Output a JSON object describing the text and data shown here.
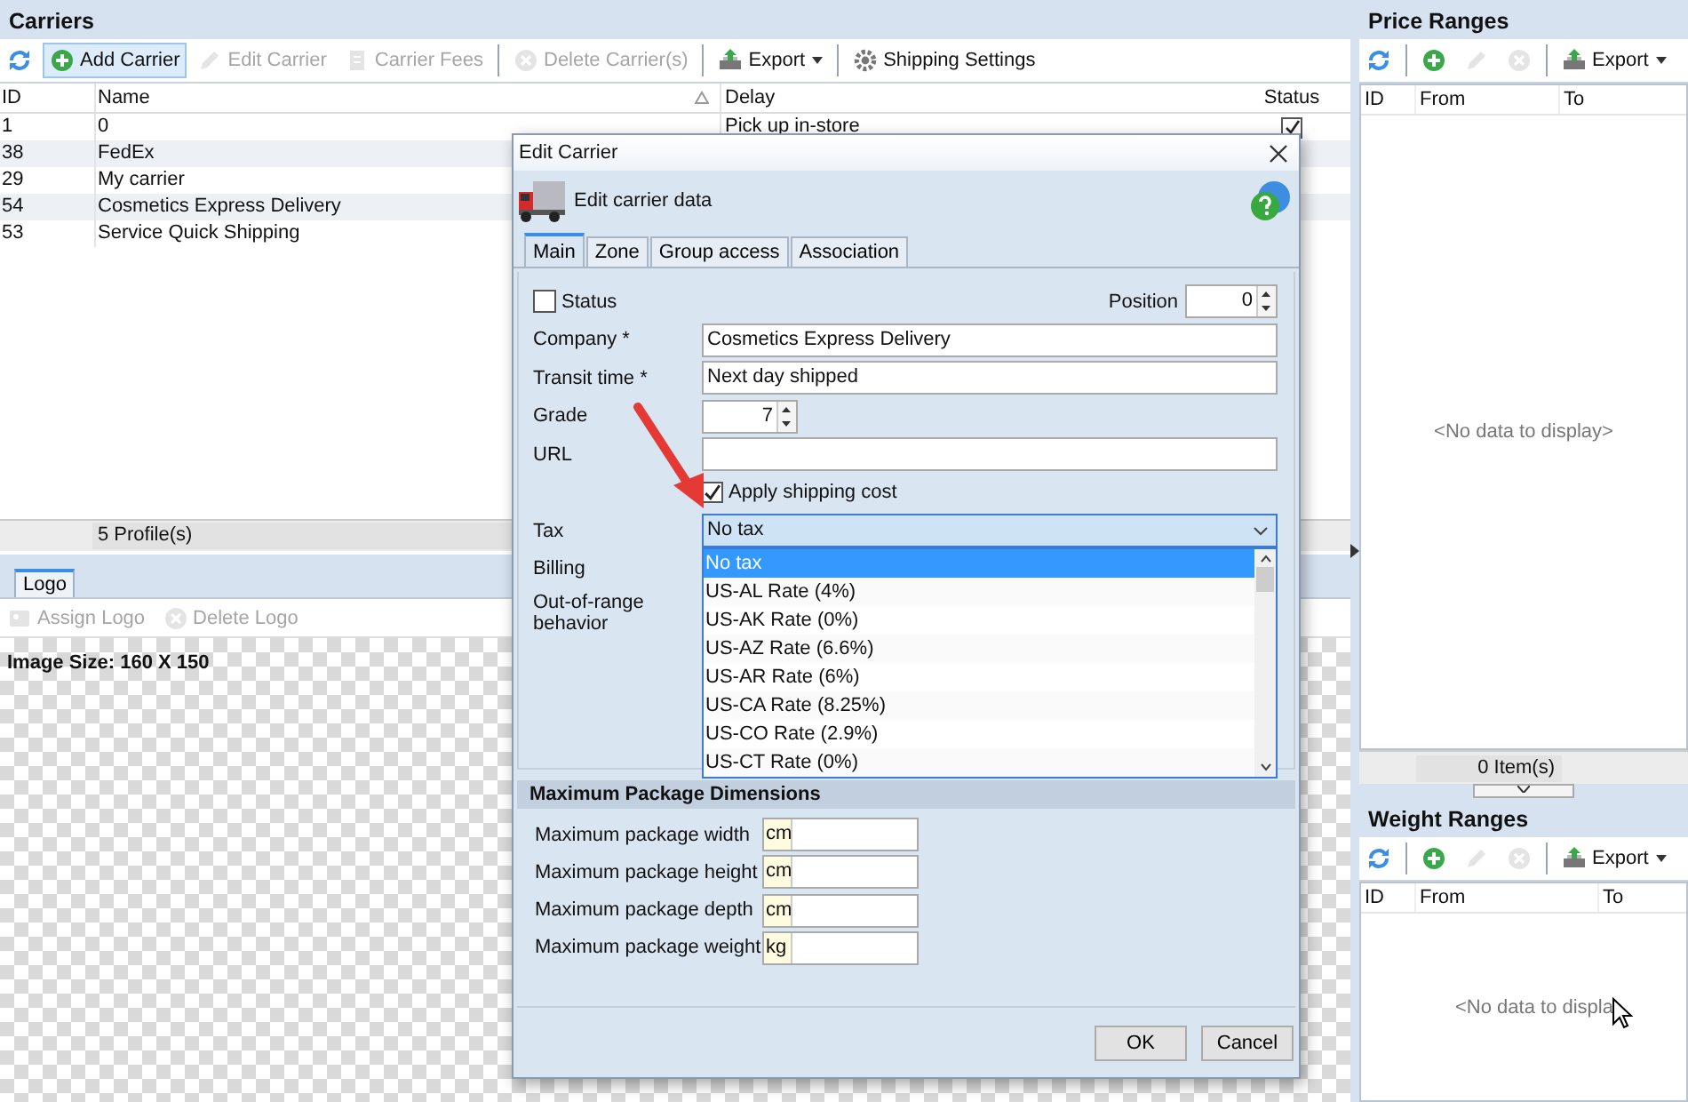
{
  "carriers": {
    "title": "Carriers",
    "toolbar": [
      {
        "kind": "refresh",
        "disabled": false,
        "hovered": false,
        "separator_before": false
      },
      {
        "kind": "add",
        "label": "Add Carrier",
        "disabled": false,
        "hovered": true,
        "separator_before": false
      },
      {
        "kind": "edit",
        "label": "Edit Carrier",
        "disabled": true,
        "hovered": false,
        "separator_before": false
      },
      {
        "kind": "fees",
        "label": "Carrier Fees",
        "disabled": true,
        "hovered": false,
        "separator_before": false
      },
      {
        "kind": "delete",
        "label": "Delete Carrier(s)",
        "disabled": true,
        "hovered": false,
        "separator_before": true
      },
      {
        "kind": "export",
        "label": "Export",
        "disabled": false,
        "hovered": false,
        "separator_before": true,
        "dropdown": true
      },
      {
        "kind": "settings",
        "label": "Shipping Settings",
        "disabled": false,
        "hovered": false,
        "separator_before": true
      }
    ],
    "columns": [
      {
        "label": "ID",
        "sorted": false
      },
      {
        "label": "Name",
        "sorted": true
      },
      {
        "label": "Delay",
        "sorted": false
      },
      {
        "label": "Status",
        "sorted": false
      }
    ],
    "rows": [
      {
        "id": "1",
        "name": "0",
        "delay": "Pick up in-store",
        "status": true
      },
      {
        "id": "38",
        "name": "FedEx"
      },
      {
        "id": "29",
        "name": "My carrier"
      },
      {
        "id": "54",
        "name": "Cosmetics Express Delivery"
      },
      {
        "id": "53",
        "name": "Service Quick Shipping"
      }
    ],
    "footer": "5 Profile(s)"
  },
  "logo": {
    "tabs": [
      {
        "label": "Logo",
        "selected": true
      }
    ],
    "toolbar": [
      {
        "kind": "assign",
        "label": "Assign Logo",
        "disabled": true
      },
      {
        "kind": "delete",
        "label": "Delete Logo",
        "disabled": true
      }
    ],
    "image_size": "Image Size: 160 X 150"
  },
  "price_ranges": {
    "title": "Price Ranges",
    "toolbar": [
      {
        "kind": "refresh",
        "disabled": false,
        "separator_before": false
      },
      {
        "kind": "add",
        "disabled": false,
        "separator_before": true
      },
      {
        "kind": "edit",
        "disabled": true,
        "separator_before": false
      },
      {
        "kind": "delete",
        "disabled": true,
        "separator_before": false
      },
      {
        "kind": "export",
        "label": "Export",
        "disabled": false,
        "separator_before": true,
        "dropdown": true
      }
    ],
    "columns": [
      "ID",
      "From",
      "To"
    ],
    "empty_text": "<No data to display>",
    "footer": "0 Item(s)"
  },
  "weight_ranges": {
    "title": "Weight Ranges",
    "toolbar": [
      {
        "kind": "refresh",
        "disabled": false,
        "separator_before": false
      },
      {
        "kind": "add",
        "disabled": false,
        "separator_before": true
      },
      {
        "kind": "edit",
        "disabled": true,
        "separator_before": false
      },
      {
        "kind": "delete",
        "disabled": true,
        "separator_before": false
      },
      {
        "kind": "export",
        "label": "Export",
        "disabled": false,
        "separator_before": true,
        "dropdown": true
      }
    ],
    "columns": [
      "ID",
      "From",
      "To"
    ],
    "empty_text": "<No data to displa"
  },
  "dialog": {
    "title": "Edit Carrier",
    "heading": "Edit carrier data",
    "tabs": [
      {
        "label": "Main",
        "selected": true
      },
      {
        "label": "Zone",
        "selected": false
      },
      {
        "label": "Group access",
        "selected": false
      },
      {
        "label": "Association",
        "selected": false
      }
    ],
    "status": {
      "label": "Status",
      "checked": false
    },
    "position": {
      "label": "Position",
      "value": "0"
    },
    "fields": [
      {
        "label": "Company *",
        "value": "Cosmetics Express Delivery"
      },
      {
        "label": "Transit time *",
        "value": "Next day shipped"
      }
    ],
    "grade": {
      "label": "Grade",
      "value": "7"
    },
    "url": {
      "label": "URL"
    },
    "apply_shipping_cost": {
      "label": "Apply shipping cost",
      "checked": true
    },
    "tax": {
      "label": "Tax",
      "value": "No tax",
      "options": [
        {
          "label": "No tax",
          "selected": true
        },
        {
          "label": "US-AL Rate (4%)",
          "selected": false
        },
        {
          "label": "US-AK Rate (0%)",
          "selected": false
        },
        {
          "label": "US-AZ Rate (6.6%)",
          "selected": false
        },
        {
          "label": "US-AR Rate (6%)",
          "selected": false
        },
        {
          "label": "US-CA Rate (8.25%)",
          "selected": false
        },
        {
          "label": "US-CO Rate (2.9%)",
          "selected": false
        },
        {
          "label": "US-CT Rate (0%)",
          "selected": false
        }
      ]
    },
    "billing": {
      "label": "Billing"
    },
    "out_of_range": {
      "label": "Out-of-range behavior"
    },
    "dimensions": {
      "title": "Maximum Package Dimensions",
      "rows": [
        {
          "label": "Maximum package width",
          "unit": "cm"
        },
        {
          "label": "Maximum package height",
          "unit": "cm"
        },
        {
          "label": "Maximum package depth",
          "unit": "cm"
        },
        {
          "label": "Maximum package weight",
          "unit": "kg"
        }
      ]
    },
    "buttons": [
      "OK",
      "Cancel"
    ]
  }
}
